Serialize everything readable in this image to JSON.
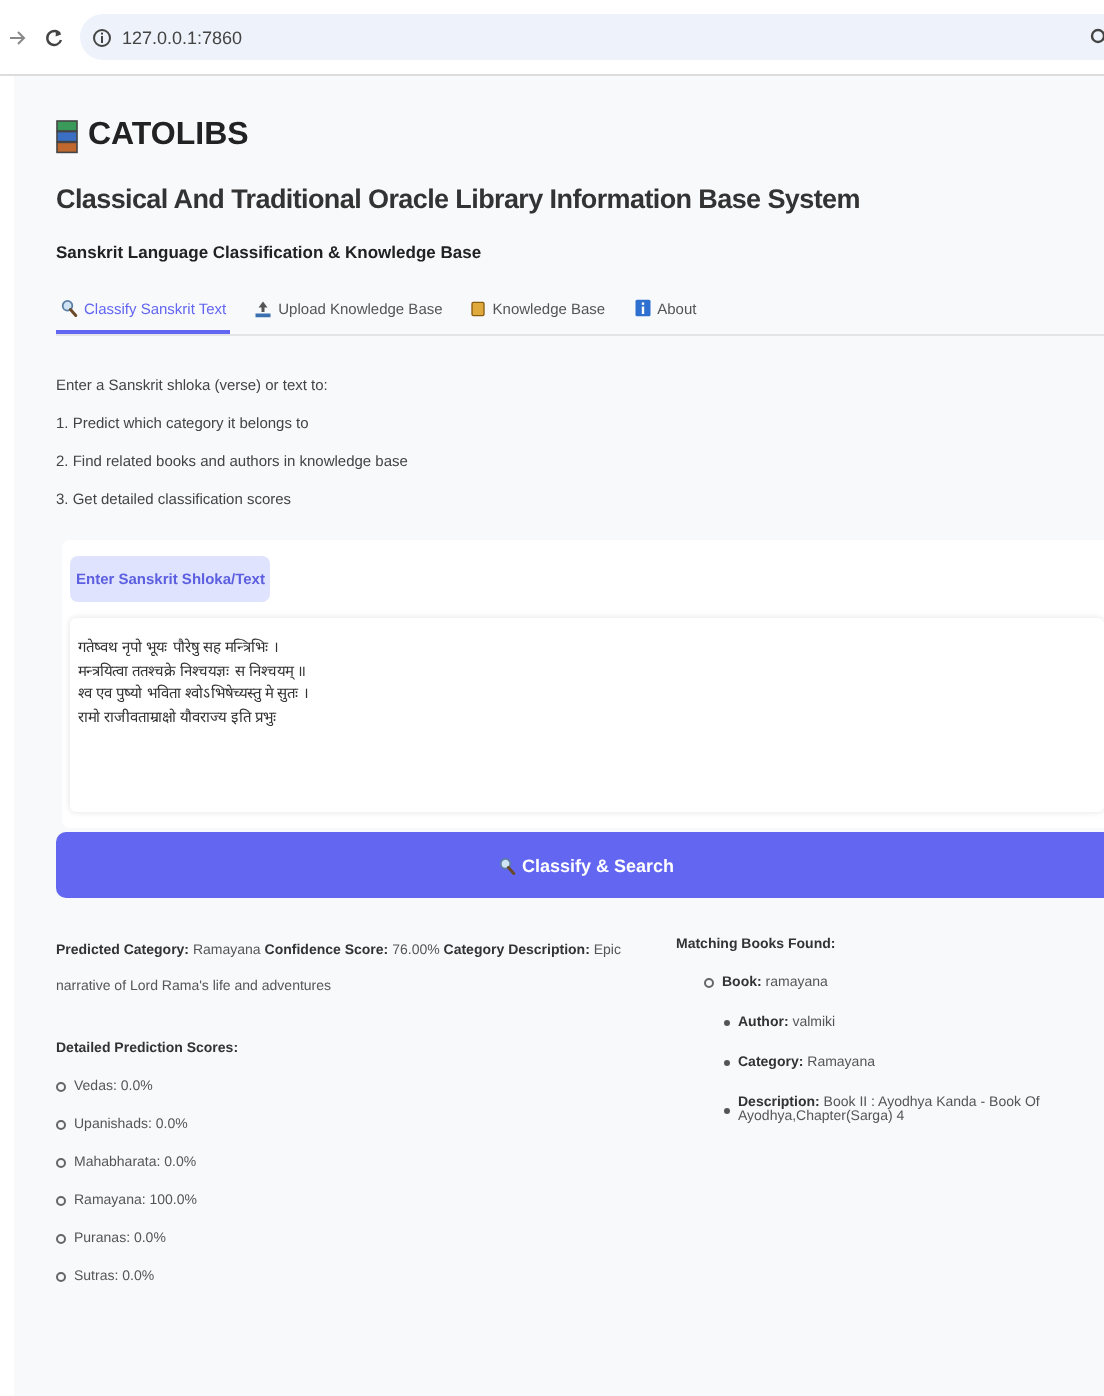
{
  "browser": {
    "url": "127.0.0.1:7860"
  },
  "app": {
    "logo_text": "CATOLIBS",
    "title": "Classical And Traditional Oracle Library Information Base System",
    "subtitle": "Sanskrit Language Classification & Knowledge Base"
  },
  "tabs": [
    {
      "label": "Classify Sanskrit Text",
      "selected": true
    },
    {
      "label": "Upload Knowledge Base",
      "selected": false
    },
    {
      "label": "Knowledge Base",
      "selected": false
    },
    {
      "label": "About",
      "selected": false
    }
  ],
  "intro": {
    "lead": "Enter a Sanskrit shloka (verse) or text to:",
    "steps": [
      "1. Predict which category it belongs to",
      "2. Find related books and authors in knowledge base",
      "3. Get detailed classification scores"
    ]
  },
  "input": {
    "label": "Enter Sanskrit Shloka/Text",
    "value": "गतेष्वथ नृपो भूयः पौरेषु सह मन्त्रिभिः ।\nमन्त्रयित्वा ततश्चक्रे निश्चयज्ञः स निश्चयम् ॥\nश्व एव पुष्यो भविता श्वोऽभिषेच्यस्तु मे सुतः ।\nरामो राजीवताम्राक्षो यौवराज्य इति प्रभुः"
  },
  "classify_button": {
    "label": "Classify & Search"
  },
  "result": {
    "summary": "**Predicted Category:** Ramayana **Confidence Score:** 76.00% **Category Description:** Epic narrative of Lord Rama's life and adventures",
    "scores_heading": "Detailed Prediction Scores:",
    "scores": [
      "Vedas: 0.0%",
      "Upanishads: 0.0%",
      "Mahabharata: 0.0%",
      "Ramayana: 100.0%",
      "Puranas: 0.0%",
      "Sutras: 0.0%"
    ]
  },
  "matches": {
    "heading": "Matching Books Found:",
    "books": [
      {
        "book": "**Book:** ramayana",
        "fields": [
          "**Author:** valmiki",
          "**Category:** Ramayana",
          "**Description:** Book II : Ayodhya Kanda - Book Of Ayodhya,Chapter(Sarga) 4"
        ]
      }
    ]
  }
}
